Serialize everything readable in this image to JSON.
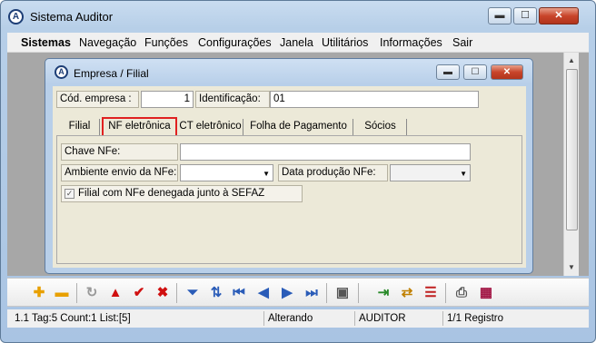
{
  "app": {
    "title": "Sistema Auditor"
  },
  "caption_buttons": {
    "minimize": "▬",
    "maximize": "☐",
    "close": "✕"
  },
  "menu": [
    "Sistemas",
    "Navegação",
    "Funções",
    "Configurações",
    "Janela",
    "Utilitários",
    "Informações",
    "Sair"
  ],
  "child": {
    "title": "Empresa / Filial",
    "minimize": "▬",
    "maximize": "☐",
    "close": "✕"
  },
  "form": {
    "cod_label": "Cód. empresa :",
    "cod_value": "1",
    "ident_label": "Identificação:",
    "ident_value": "01"
  },
  "tabs": [
    "Filial",
    "NF eletrônica",
    "CT eletrônico",
    "Folha de Pagamento",
    "Sócios"
  ],
  "nfe": {
    "chave_label": "Chave NFe:",
    "chave_value": "",
    "ambiente_label": "Ambiente envio da NFe:",
    "ambiente_value": "",
    "data_label": "Data produção NFe:",
    "data_value": "",
    "checkbox_label": "Filial com NFe denegada junto à SEFAZ",
    "checkbox_checked": true
  },
  "status": {
    "tag": "1.1 Tag:5 Count:1 List:[5]",
    "mode": "Alterando",
    "user": "AUDITOR",
    "record": "1/1 Registro"
  },
  "icons": [
    "plus-icon",
    "minus-icon",
    "refresh-icon",
    "triangle-up-icon",
    "checkmark-icon",
    "cross-icon",
    "funnel-icon",
    "sort-icon",
    "first-icon",
    "prev-icon",
    "next-icon",
    "last-icon",
    "screen-icon",
    "import-icon",
    "swap-icon",
    "list-config-icon",
    "printer-icon",
    "calendar-icon"
  ],
  "colors": {
    "highlight": "#e02020",
    "panel": "#ece9d8",
    "titlebar": "#b8cfe9"
  }
}
